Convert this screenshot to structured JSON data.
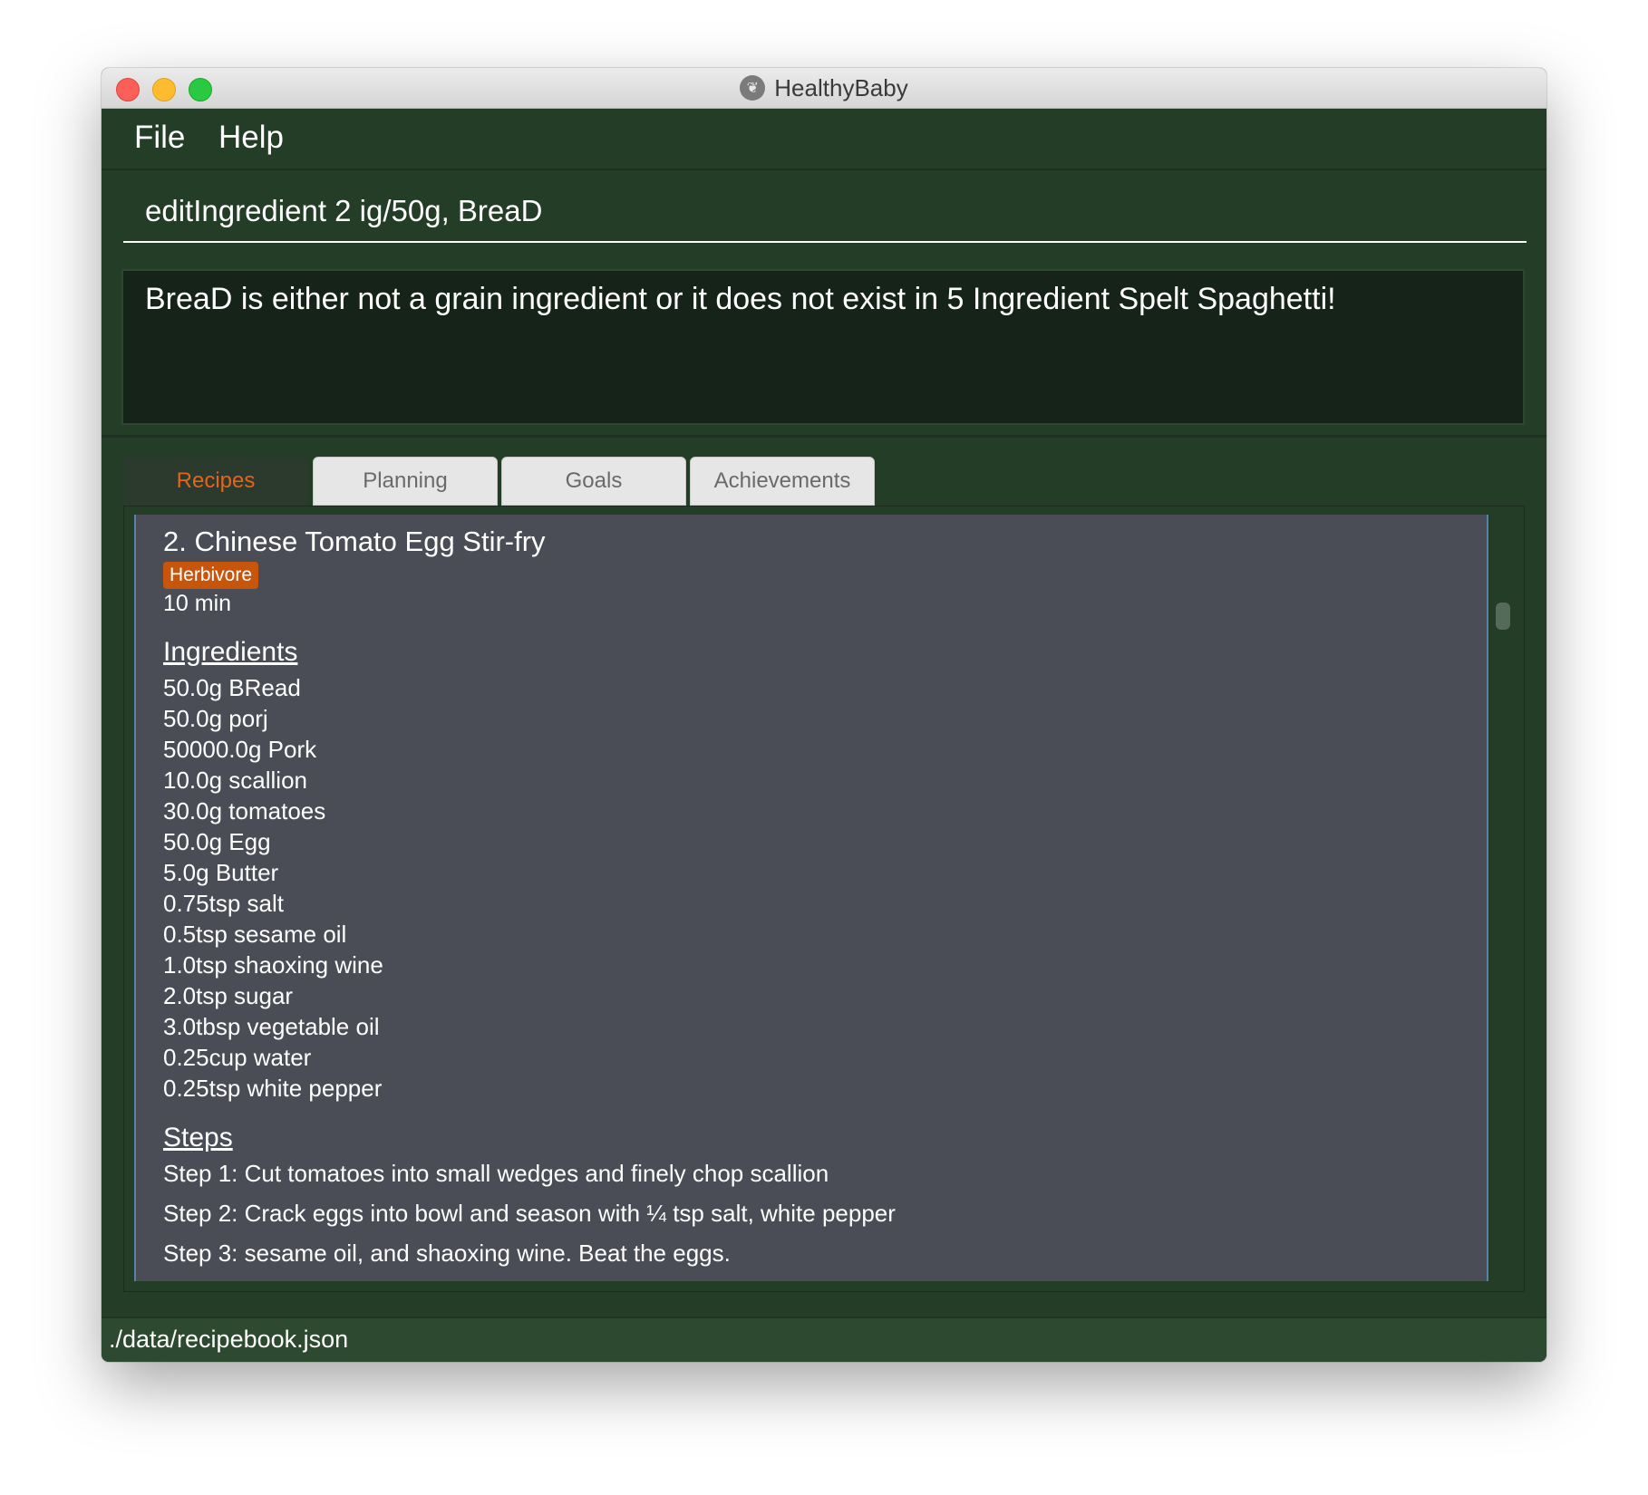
{
  "window": {
    "title": "HealthyBaby",
    "app_icon": "leaf-icon"
  },
  "menu": {
    "file_label": "File",
    "help_label": "Help"
  },
  "command": {
    "value": "editIngredient 2 ig/50g, BreaD"
  },
  "result": {
    "message": "BreaD is either not a grain ingredient or it does not exist in 5 Ingredient Spelt Spaghetti!"
  },
  "tabs": [
    {
      "label": "Recipes",
      "active": true
    },
    {
      "label": "Planning",
      "active": false
    },
    {
      "label": "Goals",
      "active": false
    },
    {
      "label": "Achievements",
      "active": false
    }
  ],
  "recipe": {
    "title": "2.  Chinese Tomato Egg Stir-fry",
    "tag": "Herbivore",
    "tag_color": "#c7550c",
    "duration": "10 min",
    "ingredients_heading": "Ingredients",
    "ingredients": [
      "50.0g BRead",
      "50.0g porj",
      "50000.0g Pork",
      "10.0g scallion",
      "30.0g tomatoes",
      "50.0g Egg",
      "5.0g Butter",
      "0.75tsp salt",
      "0.5tsp sesame oil",
      "1.0tsp shaoxing wine",
      "2.0tsp sugar",
      "3.0tbsp vegetable oil",
      "0.25cup water",
      "0.25tsp white pepper"
    ],
    "steps_heading": "Steps",
    "steps": [
      "Step 1: Cut tomatoes into small wedges and finely chop scallion",
      "Step 2: Crack eggs into bowl and season with ¼ tsp salt, white pepper",
      "Step 3: sesame oil, and shaoxing wine. Beat the eggs."
    ]
  },
  "status": {
    "path": "./data/recipebook.json"
  },
  "colors": {
    "background": "#243d27",
    "result_background": "#152319",
    "panel_background": "#4a4d55",
    "active_tab_text": "#e3651a",
    "status_background": "#2d4a30"
  }
}
